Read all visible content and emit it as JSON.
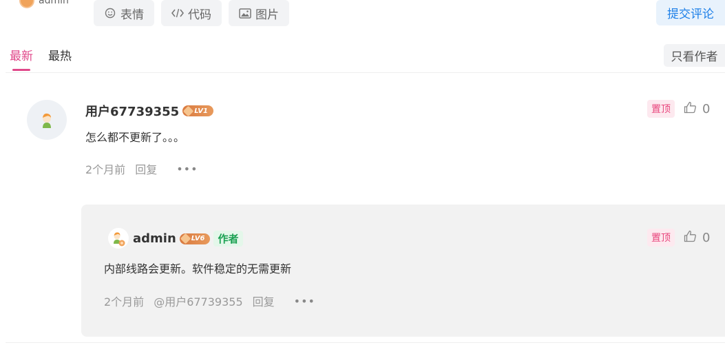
{
  "top_user": {
    "name": "admin"
  },
  "toolbar": {
    "emoji_label": "表情",
    "code_label": "代码",
    "image_label": "图片",
    "submit_label": "提交评论"
  },
  "tabs": [
    {
      "label": "最新",
      "active": true
    },
    {
      "label": "最热",
      "active": false
    }
  ],
  "filter": {
    "author_only_label": "只看作者"
  },
  "comment": {
    "user_name": "用户67739355",
    "level": "LV1",
    "text": "怎么都不更新了。。。",
    "time": "2个月前",
    "reply_label": "回复",
    "pin_label": "置顶",
    "likes": "0"
  },
  "reply": {
    "user_name": "admin",
    "level": "LV6",
    "author_tag": "作者",
    "text": "内部线路会更新。软件稳定的无需更新",
    "time": "2个月前",
    "mention": "@用户67739355",
    "reply_label": "回复",
    "pin_label": "置顶",
    "likes": "0"
  },
  "colors": {
    "accent_pink": "#e0488a",
    "submit_blue": "#1e80e8",
    "author_green": "#1aa152",
    "level_orange": "#d9793f"
  }
}
